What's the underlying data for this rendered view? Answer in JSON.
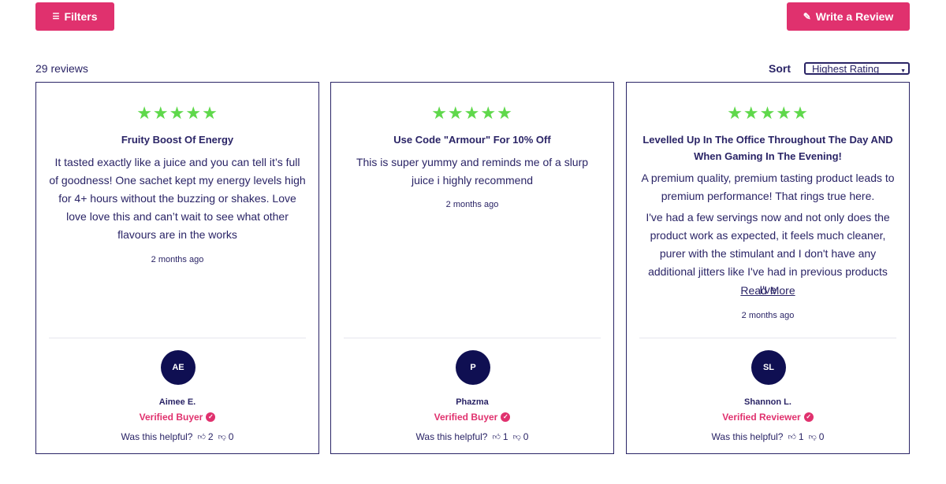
{
  "toolbar": {
    "filters_label": "Filters",
    "filters_icon": "filter-icon",
    "write_review_label": "Write a Review",
    "write_review_icon": "pencil-icon",
    "accent_color": "#e0316e"
  },
  "summary": {
    "count_text": "29 reviews",
    "sort_label": "Sort",
    "sort_selected": "Highest Rating"
  },
  "reviews": [
    {
      "rating": 5,
      "stars": "★★★★★",
      "title": "Fruity Boost Of Energy",
      "body": [
        "It tasted exactly like a juice and you can tell it’s full of goodness! One sachet kept my energy levels high for 4+ hours without the buzzing or shakes. Love love love this and can’t wait to see what other flavours are in the works"
      ],
      "date": "2 months ago",
      "initials": "AE",
      "name": "Aimee E.",
      "badge": "Verified Buyer",
      "helpful_label": "Was this helpful?",
      "helpful_up": "2",
      "helpful_down": "0"
    },
    {
      "rating": 5,
      "stars": "★★★★★",
      "title": "Use Code \"Armour\" For 10% Off",
      "body": [
        "This is super yummy and reminds me of a slurp juice i highly recommend"
      ],
      "date": "2 months ago",
      "initials": "P",
      "name": "Phazma",
      "badge": "Verified Buyer",
      "helpful_label": "Was this helpful?",
      "helpful_up": "1",
      "helpful_down": "0"
    },
    {
      "rating": 5,
      "stars": "★★★★★",
      "title": "Levelled Up In The Office Throughout The Day AND When Gaming In The Evening!",
      "body": [
        "A premium quality, premium tasting product leads to premium performance! That rings true here.",
        "I've had a few servings now and not only does the product work as expected, it feels much cleaner, purer with the stimulant and I don't have any additional jitters like I've had in previous products I've"
      ],
      "read_more": "Read More",
      "date": "2 months ago",
      "initials": "SL",
      "name": "Shannon L.",
      "badge": "Verified Reviewer",
      "helpful_label": "Was this helpful?",
      "helpful_up": "1",
      "helpful_down": "0"
    }
  ]
}
